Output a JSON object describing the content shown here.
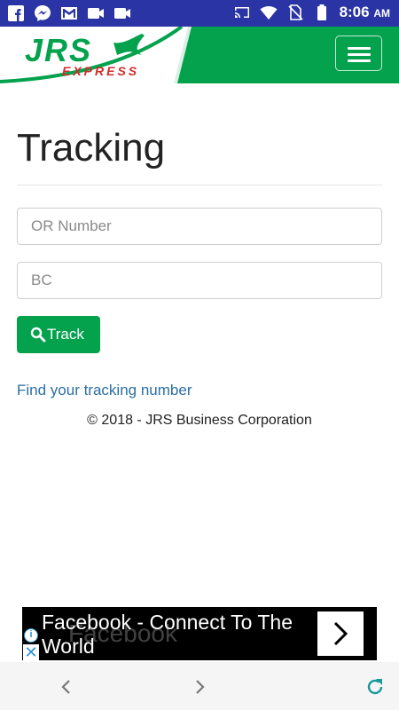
{
  "status_bar": {
    "time": "8:06",
    "ampm": "AM",
    "left_icons": [
      "facebook-icon",
      "messenger-icon",
      "gmail-icon",
      "video-icon",
      "video-icon"
    ],
    "right_icons": [
      "cast-icon",
      "wifi-icon",
      "no-sim-icon",
      "battery-icon"
    ]
  },
  "header": {
    "logo_text": "JRS",
    "logo_subtext": "EXPRESS",
    "brand_color": "#05a24e",
    "menu_icon": "hamburger-icon"
  },
  "main": {
    "title": "Tracking",
    "or_placeholder": "OR Number",
    "bc_placeholder": "BC",
    "track_label": "Track",
    "find_link": "Find your tracking number",
    "footer": "© 2018 - JRS Business Corporation"
  },
  "ad": {
    "text": "Facebook - Connect To The World",
    "ghost_text": "Facebook"
  },
  "nav": {
    "icons": [
      "back-icon",
      "forward-icon",
      "refresh-icon"
    ]
  }
}
